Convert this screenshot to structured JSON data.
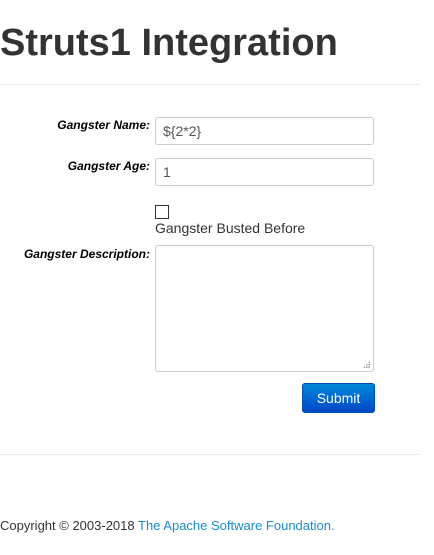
{
  "page": {
    "title": "Struts1 Integration"
  },
  "form": {
    "name_label": "Gangster Name:",
    "name_value": "${2*2}",
    "age_label": "Gangster Age:",
    "age_value": "1",
    "busted_label": "Gangster Busted Before",
    "busted_checked": false,
    "description_label": "Gangster Description:",
    "description_value": "",
    "submit_label": "Submit"
  },
  "footer": {
    "copyright": "Copyright © 2003-2018 ",
    "link": "The Apache Software Foundation."
  },
  "colors": {
    "accent": "#0066cc",
    "link": "#1a8bd0"
  }
}
